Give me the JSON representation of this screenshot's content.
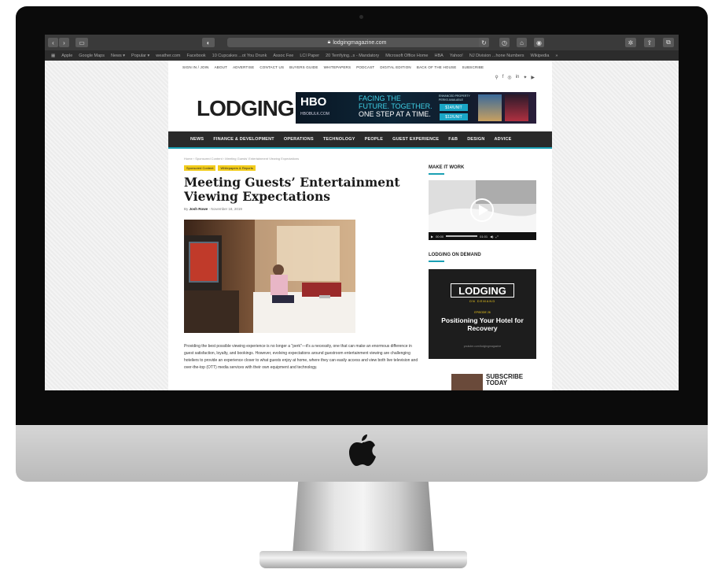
{
  "browser": {
    "url": "lodgingmagazine.com",
    "bookmarks": [
      "Apple",
      "Google Maps",
      "News ▾",
      "Popular ▾",
      "weather.com",
      "Facebook",
      "10 Cupcakes ...ot You Drunk",
      "Assoc Fee",
      "LCI Paper",
      "20 Terrifying...s - Mandatory",
      "Microsoft Office Home",
      "HBA",
      "Yahoo!",
      "NJ Division ...hone Numbers",
      "Wikipedia"
    ],
    "more": "»"
  },
  "site": {
    "logo": "LODGING",
    "top_nav": [
      "SIGN IN / JOIN",
      "ABOUT",
      "ADVERTISE",
      "CONTACT US",
      "BUYERS GUIDE",
      "WHITEPAPERS",
      "PODCAST",
      "DIGITAL EDITION",
      "BACK OF THE HOUSE",
      "SUBSCRIBE"
    ],
    "main_nav": [
      "NEWS",
      "FINANCE & DEVELOPMENT",
      "OPERATIONS",
      "TECHNOLOGY",
      "PEOPLE",
      "GUEST EXPERIENCE",
      "F&B",
      "DESIGN",
      "ADVICE"
    ]
  },
  "ad": {
    "brand": "HBO",
    "brand_sub": "HBOBULK.COM",
    "headline_1": "FACING THE",
    "headline_2": "FUTURE. TOGETHER.",
    "headline_3": "ONE STEP AT A TIME.",
    "offer": "ENHANCED PROPERTY PERKS AVAILABLE",
    "price_1": "$14/UNIT",
    "price_2": "$12/UNIT"
  },
  "article": {
    "breadcrumb": "Home  ›  Sponsored Content  ›  Meeting Guests' Entertainment Viewing Expectations",
    "tags": [
      "Sponsored Content",
      "Whitepapers & Reports"
    ],
    "title": "Meeting Guests’ Entertainment Viewing Expectations",
    "by": "By",
    "author": "Josh Rowe",
    "date": "- November 18, 2019",
    "body": "Providing the best possible viewing experience is no longer a \"perk\"—it's a necessity, one that can make an enormous difference in guest satisfaction, loyalty, and bookings. However, evolving expectations around guestroom entertainment viewing are challenging hoteliers to provide an experience closer to what guests enjoy at home, where they can easily access and view both live television and over-the-top (OTT) media services with their own equipment and technology."
  },
  "sidebar": {
    "make_it_work": "MAKE IT WORK",
    "video_time": "00:00",
    "video_duration": "01:01",
    "on_demand_heading": "LODGING ON DEMAND",
    "od_logo": "LODGING",
    "od_sub": "ON DEMAND",
    "od_episode": "EPISODE 26",
    "od_title": "Positioning Your Hotel for Recovery",
    "od_url": "youtube.com/lodgingmagazine",
    "subscribe": "SUBSCRIBE TODAY"
  }
}
